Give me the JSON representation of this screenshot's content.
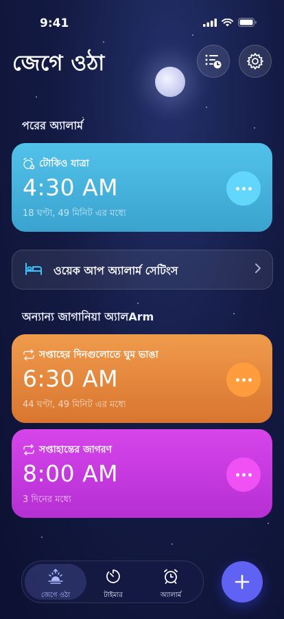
{
  "status": {
    "time": "9:41"
  },
  "header": {
    "title": "জেগে ওঠা"
  },
  "next": {
    "section_label": "পরের অ্যালার্ম",
    "alarm": {
      "name": "টোকিও যাত্রা",
      "time": "4:30 AM",
      "subtitle": "18 ঘণ্টা, 49 মিনিট এর মধ্যে"
    }
  },
  "wake_settings": {
    "label": "ওয়েক আপ অ্যালার্ম সেটিংস"
  },
  "other": {
    "section_label": "অন্যান্য জাগানিয়া অ্যালArm",
    "alarms": [
      {
        "name": "সপ্তাহের দিনগুলোতে ঘুম ভাঙা",
        "time": "6:30 AM",
        "subtitle": "44 ঘণ্টা, 49 মিনিট এর মধ্যে"
      },
      {
        "name": "সপ্তাহান্তের জাগরণ",
        "time": "8:00 AM",
        "subtitle": "3 দিনের মধ্যে"
      }
    ]
  },
  "tabbar": {
    "tabs": [
      {
        "label": "জেগে ওঠা",
        "icon": "sunrise-icon",
        "active": true
      },
      {
        "label": "টাইমার",
        "icon": "timer-icon",
        "active": false
      },
      {
        "label": "অ্যালার্ম",
        "icon": "alarm-clock-icon",
        "active": false
      }
    ]
  },
  "colors": {
    "accent": "#5f62f2",
    "card1": "#4ab7e2",
    "card2": "#e5883d",
    "card3": "#c83ae0"
  }
}
